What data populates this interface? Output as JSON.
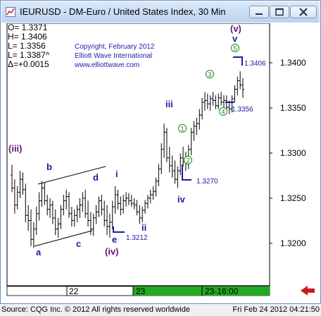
{
  "window": {
    "title": "IEURUSD - DM-Euro / United States Index, 30 Min"
  },
  "readout": {
    "open": "O=  1.3371",
    "high": "H=  1.3406",
    "low": "L=  1.3356",
    "last": "L=  1.3387^",
    "delta": "Δ=+0.0015"
  },
  "copyright": {
    "line1": "Copyright, February 2012",
    "line2": "Elliott Wave International",
    "line3": "www.elliottwave.com"
  },
  "chart_data": {
    "type": "bar",
    "title": "IEURUSD - DM-Euro / United States Index, 30 Min",
    "y_ticks": [
      "1.3400",
      "1.3350",
      "1.3300",
      "1.3250",
      "1.3200"
    ],
    "y_tick_values": [
      1.34,
      1.335,
      1.33,
      1.325,
      1.32
    ],
    "ylim": [
      1.3156,
      1.3462
    ],
    "x_ticks": [
      "22",
      "23",
      "23-16:00"
    ],
    "grid": false,
    "price_labels": [
      "1.3406",
      "1.3356",
      "1.3270",
      "1.3212"
    ],
    "wave_labels": [
      "(iii)",
      "a",
      "b",
      "c",
      "d",
      "e",
      "(iv)",
      "i",
      "ii",
      "iii",
      "iv",
      "v",
      "(v)",
      "1",
      "2",
      "3",
      "4",
      "5"
    ],
    "ohlc": [
      [
        1.3285,
        1.3297,
        1.3265,
        1.327
      ],
      [
        1.327,
        1.328,
        1.324,
        1.325
      ],
      [
        1.325,
        1.3272,
        1.3245,
        1.3265
      ],
      [
        1.3265,
        1.329,
        1.3258,
        1.328
      ],
      [
        1.328,
        1.3288,
        1.3262,
        1.3268
      ],
      [
        1.3268,
        1.3275,
        1.323,
        1.3238
      ],
      [
        1.3238,
        1.325,
        1.322,
        1.3232
      ],
      [
        1.3232,
        1.3245,
        1.3202,
        1.321
      ],
      [
        1.321,
        1.323,
        1.32,
        1.3222
      ],
      [
        1.3222,
        1.3248,
        1.3215,
        1.324
      ],
      [
        1.324,
        1.3265,
        1.3232,
        1.3255
      ],
      [
        1.3255,
        1.3278,
        1.3248,
        1.327
      ],
      [
        1.327,
        1.3276,
        1.325,
        1.3255
      ],
      [
        1.3255,
        1.3262,
        1.3238,
        1.3245
      ],
      [
        1.3245,
        1.3258,
        1.3235,
        1.325
      ],
      [
        1.325,
        1.3255,
        1.3228,
        1.3235
      ],
      [
        1.3235,
        1.3245,
        1.3215,
        1.3222
      ],
      [
        1.3222,
        1.3235,
        1.3212,
        1.3228
      ],
      [
        1.3228,
        1.325,
        1.3222,
        1.3245
      ],
      [
        1.3245,
        1.3262,
        1.3238,
        1.3255
      ],
      [
        1.3255,
        1.3268,
        1.3245,
        1.326
      ],
      [
        1.326,
        1.3265,
        1.3235,
        1.324
      ],
      [
        1.324,
        1.3248,
        1.3225,
        1.3232
      ],
      [
        1.3232,
        1.3245,
        1.3225,
        1.3238
      ],
      [
        1.3238,
        1.325,
        1.323,
        1.3245
      ],
      [
        1.3245,
        1.3258,
        1.3235,
        1.325
      ],
      [
        1.325,
        1.3265,
        1.3242,
        1.3258
      ],
      [
        1.3258,
        1.3268,
        1.3235,
        1.324
      ],
      [
        1.324,
        1.3255,
        1.3225,
        1.3232
      ],
      [
        1.3232,
        1.3242,
        1.3215,
        1.3222
      ],
      [
        1.3222,
        1.324,
        1.3214,
        1.3235
      ],
      [
        1.3235,
        1.325,
        1.3228,
        1.3242
      ],
      [
        1.3242,
        1.326,
        1.3236,
        1.3255
      ],
      [
        1.3255,
        1.3262,
        1.3238,
        1.3245
      ],
      [
        1.3245,
        1.3255,
        1.3225,
        1.3232
      ],
      [
        1.3232,
        1.325,
        1.3215,
        1.3225
      ],
      [
        1.3225,
        1.324,
        1.3212,
        1.323
      ],
      [
        1.323,
        1.3255,
        1.3222,
        1.3248
      ],
      [
        1.3248,
        1.3272,
        1.324,
        1.3262
      ],
      [
        1.3262,
        1.3268,
        1.3245,
        1.3252
      ],
      [
        1.3252,
        1.326,
        1.3238,
        1.3245
      ],
      [
        1.3245,
        1.3262,
        1.324,
        1.3255
      ],
      [
        1.3255,
        1.3265,
        1.3248,
        1.3258
      ],
      [
        1.3258,
        1.3264,
        1.325,
        1.3255
      ],
      [
        1.3255,
        1.3262,
        1.3248,
        1.3252
      ],
      [
        1.3252,
        1.3258,
        1.3245,
        1.325
      ],
      [
        1.325,
        1.3256,
        1.3238,
        1.3242
      ],
      [
        1.3242,
        1.325,
        1.3228,
        1.3235
      ],
      [
        1.3235,
        1.3248,
        1.323,
        1.3244
      ],
      [
        1.3244,
        1.3256,
        1.324,
        1.3252
      ],
      [
        1.3252,
        1.3262,
        1.3246,
        1.3258
      ],
      [
        1.3258,
        1.3268,
        1.3252,
        1.3262
      ],
      [
        1.3262,
        1.3272,
        1.3256,
        1.3266
      ],
      [
        1.3266,
        1.3282,
        1.326,
        1.3278
      ],
      [
        1.3278,
        1.3298,
        1.3272,
        1.3292
      ],
      [
        1.3292,
        1.3322,
        1.3286,
        1.3315
      ],
      [
        1.3315,
        1.3345,
        1.3305,
        1.3335
      ],
      [
        1.3335,
        1.334,
        1.33,
        1.3305
      ],
      [
        1.3305,
        1.3318,
        1.3288,
        1.3296
      ],
      [
        1.3296,
        1.3308,
        1.3282,
        1.329
      ],
      [
        1.329,
        1.3302,
        1.3275,
        1.328
      ],
      [
        1.328,
        1.3295,
        1.327,
        1.329
      ],
      [
        1.329,
        1.331,
        1.3285,
        1.3305
      ],
      [
        1.3305,
        1.3318,
        1.3295,
        1.33
      ],
      [
        1.33,
        1.3312,
        1.329,
        1.3298
      ],
      [
        1.3298,
        1.332,
        1.3292,
        1.3315
      ],
      [
        1.3315,
        1.334,
        1.3308,
        1.3335
      ],
      [
        1.3335,
        1.3348,
        1.3325,
        1.3342
      ],
      [
        1.3342,
        1.3352,
        1.3332,
        1.3345
      ],
      [
        1.3345,
        1.3362,
        1.3338,
        1.3355
      ],
      [
        1.3355,
        1.3375,
        1.335,
        1.337
      ],
      [
        1.337,
        1.3382,
        1.336,
        1.3372
      ],
      [
        1.3372,
        1.338,
        1.3362,
        1.3368
      ],
      [
        1.3368,
        1.3378,
        1.336,
        1.3374
      ],
      [
        1.3374,
        1.3382,
        1.3366,
        1.3372
      ],
      [
        1.3372,
        1.3378,
        1.3362,
        1.3366
      ],
      [
        1.3366,
        1.338,
        1.3362,
        1.3375
      ],
      [
        1.3375,
        1.3382,
        1.3366,
        1.337
      ],
      [
        1.337,
        1.3378,
        1.3362,
        1.3372
      ],
      [
        1.3372,
        1.3378,
        1.336,
        1.3364
      ],
      [
        1.3364,
        1.3372,
        1.3356,
        1.3362
      ],
      [
        1.3362,
        1.3378,
        1.3358,
        1.3374
      ],
      [
        1.3374,
        1.339,
        1.337,
        1.3385
      ],
      [
        1.3385,
        1.34,
        1.3378,
        1.3395
      ],
      [
        1.3395,
        1.3406,
        1.3385,
        1.339
      ],
      [
        1.339,
        1.3398,
        1.3375,
        1.3385
      ]
    ]
  },
  "status_bar": {
    "left": "Source: CQG Inc. © 2012 All rights reserved worldwide",
    "right": "Fri Feb 24 2012 04:21:50"
  },
  "colors": {
    "title_gradient_top": "#dbe8f8",
    "title_gradient_bottom": "#bcd3ee",
    "bars": "#000000",
    "annotation_blue": "#1a1aa0",
    "annotation_purple": "#5a1a6e",
    "minor_wave_green": "#1a8a1a",
    "copyright_blue": "#2020b0",
    "scroll_green": "#22aa22",
    "arrow_red": "#cc1a1a"
  }
}
